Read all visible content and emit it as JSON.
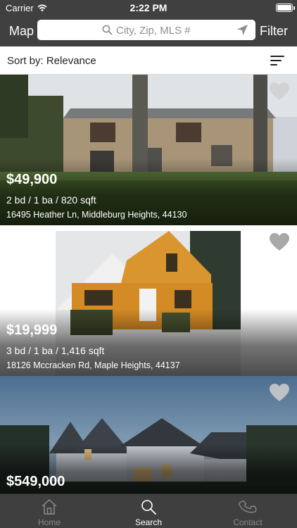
{
  "status_bar": {
    "carrier": "Carrier",
    "time": "2:22 PM"
  },
  "nav": {
    "map_label": "Map",
    "filter_label": "Filter",
    "search_placeholder": "City, Zip, MLS #"
  },
  "sort": {
    "label": "Sort by: Relevance"
  },
  "listings": [
    {
      "price": "$49,900",
      "specs": "2 bd / 1 ba / 820 sqft",
      "address": "16495 Heather Ln, Middleburg Heights, 44130"
    },
    {
      "price": "$19,999",
      "specs": "3 bd / 1 ba / 1,416 sqft",
      "address": "18126 Mccracken Rd, Maple Heights, 44137"
    },
    {
      "price": "$549,000",
      "specs": "",
      "address": ""
    }
  ],
  "tabs": [
    {
      "label": "Home",
      "icon": "home-icon",
      "active": false
    },
    {
      "label": "Search",
      "icon": "search-icon",
      "active": true
    },
    {
      "label": "Contact",
      "icon": "phone-icon",
      "active": false
    }
  ],
  "colors": {
    "bar_background": "#404040",
    "tab_inactive": "#8a8a8a",
    "tab_active": "#ffffff",
    "heart": "#cfcfcf"
  }
}
